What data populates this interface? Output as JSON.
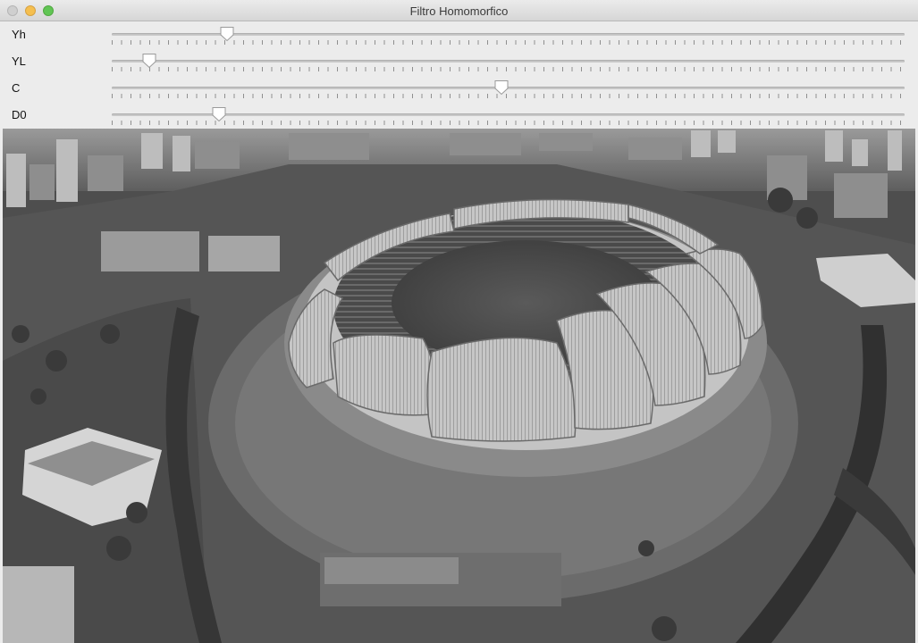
{
  "window": {
    "title": "Filtro Homomorfico"
  },
  "sliders": [
    {
      "label": "Yh",
      "value": 0.145
    },
    {
      "label": "YL",
      "value": 0.047
    },
    {
      "label": "C",
      "value": 0.491
    },
    {
      "label": "D0",
      "value": 0.135
    }
  ],
  "image": {
    "description_icon": "stadium-photo",
    "mode": "grayscale"
  },
  "colors": {
    "titlebar": "#dcdcdc",
    "panel": "#ececec",
    "close": "#cfcfcf",
    "minimize": "#f5bf4f",
    "maximize": "#61c554"
  }
}
